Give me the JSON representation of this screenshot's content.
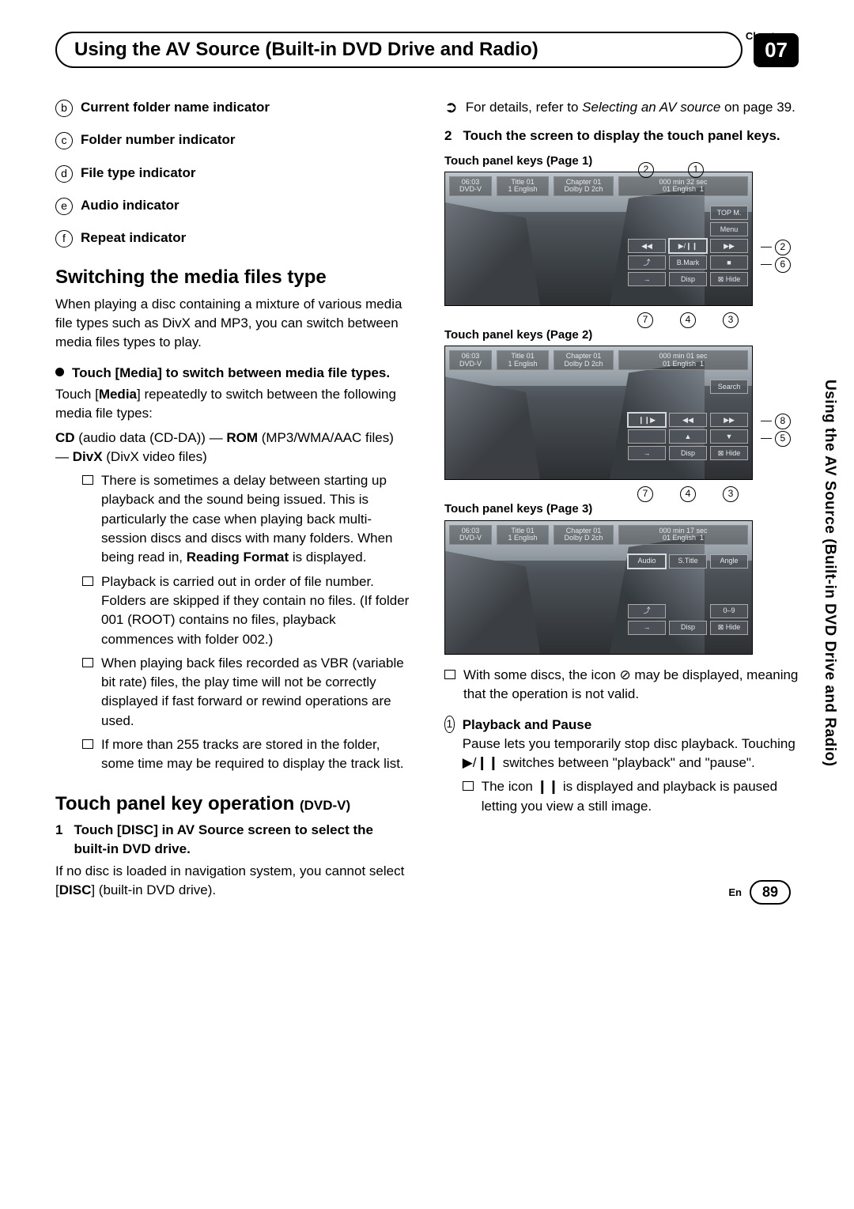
{
  "chapter_label": "Chapter",
  "chapter_number": "07",
  "page_title": "Using the AV Source (Built-in DVD Drive and Radio)",
  "side_text": "Using the AV Source (Built-in DVD Drive and Radio)",
  "footer_lang": "En",
  "footer_page": "89",
  "left": {
    "indicators": [
      {
        "n": "b",
        "label": "Current folder name indicator"
      },
      {
        "n": "c",
        "label": "Folder number indicator"
      },
      {
        "n": "d",
        "label": "File type indicator"
      },
      {
        "n": "e",
        "label": "Audio indicator"
      },
      {
        "n": "f",
        "label": "Repeat indicator"
      }
    ],
    "sect1_title": "Switching the media files type",
    "sect1_body": "When playing a disc containing a mixture of various media file types such as DivX and MP3, you can switch between media files types to play.",
    "dothead": "Touch [Media] to switch between media file types.",
    "touch_media_line1_a": "Touch [",
    "touch_media_line1_b": "Media",
    "touch_media_line1_c": "] repeatedly to switch between the following media file types:",
    "cd_line_a": "CD",
    "cd_line_b": " (audio data (CD-DA)) — ",
    "cd_line_c": "ROM",
    "cd_line_d": " (MP3/WMA/AAC files) — ",
    "cd_line_e": "DivX",
    "cd_line_f": " (DivX video files)",
    "bullets": [
      {
        "pre": "There is sometimes a delay between starting up playback and the sound being issued. This is particularly the case when playing back multi-session discs and discs with many folders. When being read in, ",
        "bold": "Reading Format",
        "post": " is displayed."
      },
      {
        "pre": "Playback is carried out in order of file number. Folders are skipped if they contain no files. (If folder 001 (ROOT) contains no files, playback commences with folder 002.)",
        "bold": "",
        "post": ""
      },
      {
        "pre": "When playing back files recorded as VBR (variable bit rate) files, the play time will not be correctly displayed if fast forward or rewind operations are used.",
        "bold": "",
        "post": ""
      },
      {
        "pre": "If more than 255 tracks are stored in the folder, some time may be required to display the track list.",
        "bold": "",
        "post": ""
      }
    ],
    "sect2_title_a": "Touch panel key operation ",
    "sect2_title_b": "(DVD-V)",
    "step1_head": "Touch [DISC] in AV Source screen to select the built-in DVD drive.",
    "step1_body_a": "If no disc is loaded in navigation system, you cannot select [",
    "step1_body_b": "DISC",
    "step1_body_c": "] (built-in DVD drive)."
  },
  "right": {
    "arrow_a": "For details, refer to ",
    "arrow_i": "Selecting an AV source",
    "arrow_b": " on page 39.",
    "step2_head": "Touch the screen to display the touch panel keys.",
    "cap1": "Touch panel keys (Page 1)",
    "cap2": "Touch panel keys (Page 2)",
    "cap3": "Touch panel keys (Page 3)",
    "osd": {
      "time": "06:03",
      "dvdv": "DVD-V",
      "title": "Title  01",
      "chapter": "Chapter 01",
      "lang1": "1 English",
      "dolby": "Dolby D  2ch",
      "lang2": "01 English",
      "dur1a": "000 min  32 sec",
      "dur1b": "1",
      "dur2a": "000 min  01 sec",
      "dur3a": "000 min  17 sec"
    },
    "p1_btns": {
      "topm": "TOP M.",
      "menu": "Menu",
      "bmark": "B.Mark",
      "disp": "Disp",
      "hide": "⊠ Hide"
    },
    "p2_btns": {
      "search": "Search",
      "disp": "Disp",
      "hide": "⊠ Hide"
    },
    "p3_btns": {
      "audio": "Audio",
      "stitle": "S.Title",
      "angle": "Angle",
      "zero9": "0–9",
      "disp": "Disp",
      "hide": "⊠ Hide"
    },
    "disc_note": "With some discs, the icon ⊘ may be displayed, meaning that the operation is not valid.",
    "pb_head": "Playback and Pause",
    "pb_body": "Pause lets you temporarily stop disc playback. Touching ▶/❙❙ switches between \"playback\" and \"pause\".",
    "pb_bullet": "The icon ❙❙ is displayed and playback is paused letting you view a still image."
  }
}
